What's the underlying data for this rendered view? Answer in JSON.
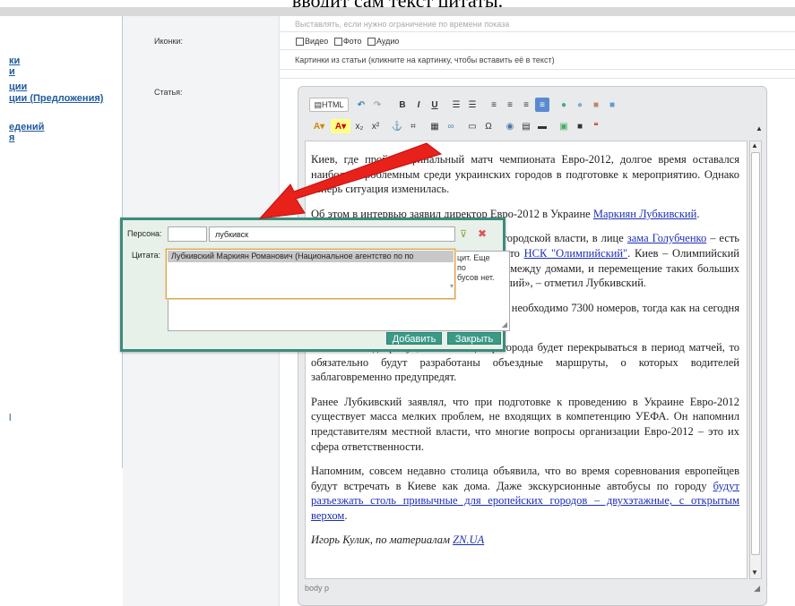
{
  "caption": "вводит сам текст цитаты.",
  "leftnav": {
    "items": [
      "ки",
      "и",
      "ции",
      "ции (Предложения)",
      "едений",
      "я",
      "l"
    ]
  },
  "form": {
    "time_hint": "Выставлять, если нужно ограничение по времени показа",
    "icons_label": "Иконки:",
    "icon_options": [
      "Видео",
      "Фото",
      "Аудио"
    ],
    "pictures_hint": "Картинки из статьи (кликните на картинку, чтобы вставить её в текст)",
    "article_label": "Статья:"
  },
  "toolbar": {
    "html_label": "HTML",
    "bold": "B",
    "italic": "I",
    "underline": "U"
  },
  "article": {
    "p1_a": "Киев, где пройдет финальный матч чемпионата Евро-2012, долгое время оставался наиболее проблемным среди украинских городов в подготовке к мероприятию. Однако теперь ситуация изменилась.",
    "p2_a": "Об этом в интервью заявил директор Евро-2012 в Украине ",
    "p2_link": "Маркиян Лубкивский",
    "p2_b": ".",
    "p3_a": "«Мне кажется, что сегодня со стороны городской власти, в лице ",
    "p3_link1": "зама Голубченко",
    "p3_b": " – есть полное понимание проблем. Главная – это ",
    "p3_link2": "НСК \"Олимпийский\"",
    "p3_c": ". Киев – Олимпийский стадион находится в центре мегаполиса между домами, и перемещение таких больших масс людей требует дополнительных усилий», – отметил Лубкивский.",
    "p4": "По его словам, для целевых групп УЕФА необходимо 7300 номеров, тогда как на сегодня имеется около 6200.",
    "p5": "Он также подчеркнул, что если центр города будет перекрываться в период матчей, то обязательно будут разработаны объездные маршруты, о которых водителей заблаговременно предупредят.",
    "p6": "Ранее Лубкивский заявлял, что при подготовке к проведению в Украине Евро-2012 существует масса мелких проблем, не входящих в компетенцию УЕФА. Он напомнил представителям местной власти, что многие вопросы организации Евро-2012 – это их сфера ответственности.",
    "p7_a": "Напомним, совсем недавно столица объявила, что во время соревнования европейцев будут встречать в Киеве как дома. Даже экскурсионные автобусы по городу ",
    "p7_link": "будут разъезжать столь привычные для еропейских городов – двухэтажные, с открытым верхом",
    "p7_b": ".",
    "p8_a": "Игорь Кулик, по материалам ",
    "p8_link": "ZN.UA"
  },
  "status_path": "body  p",
  "popup": {
    "persona_label": "Персона:",
    "persona_input": "лубкивск",
    "quote_label": "Цитата:",
    "suggestion": "Лубкивский Маркиян Романович (Национальное агентство по по",
    "behind_text_1": "цит. Еще",
    "behind_text_2": "по",
    "behind_text_3": "бусов нет.",
    "add_button": "Добавить",
    "close_button": "Закрыть"
  },
  "colors": {
    "popup_border": "#3c8c7c",
    "button": "#3a9a86",
    "link": "#1b2fb3",
    "arrow": "#e8211b"
  }
}
